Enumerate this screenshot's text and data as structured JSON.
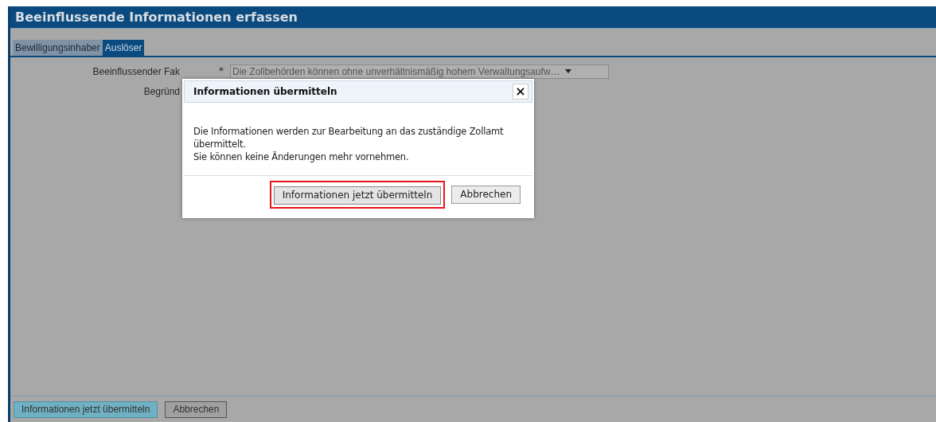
{
  "page": {
    "title": "Beeinflussende Informationen erfassen"
  },
  "tabs": [
    {
      "label": "Bewilligungsinhaber",
      "selected": false
    },
    {
      "label": "Auslöser",
      "selected": true
    }
  ],
  "form": {
    "fields": [
      {
        "label": "Beeinflussender Fak",
        "required_mark": "*",
        "value": "Die Zollbehörden können ohne unverhältnismäßig hohem Verwaltungsaufw…"
      },
      {
        "label": "Begründ"
      }
    ]
  },
  "footer": {
    "buttons": [
      {
        "label": "Informationen jetzt übermitteln",
        "kind": "primary"
      },
      {
        "label": "Abbrechen",
        "kind": "secondary"
      }
    ]
  },
  "dialog": {
    "title": "Informationen übermitteln",
    "close": "×",
    "message_lines": [
      "Die Informationen werden zur Bearbeitung an das zuständige Zollamt übermittelt.",
      "Sie können keine Änderungen mehr vornehmen."
    ],
    "buttons": [
      {
        "label": "Informationen jetzt übermitteln",
        "highlighted": true
      },
      {
        "label": "Abbrechen",
        "highlighted": false
      }
    ]
  }
}
